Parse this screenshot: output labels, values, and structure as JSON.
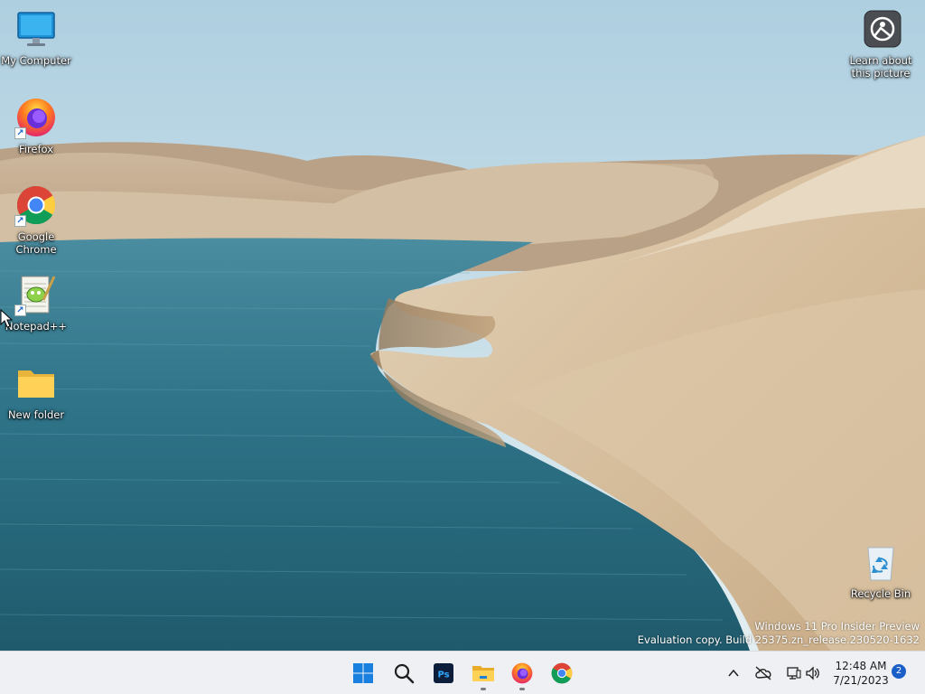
{
  "desktop": {
    "icons": [
      {
        "label": "My Computer"
      },
      {
        "label": "Firefox"
      },
      {
        "label": "Google Chrome"
      },
      {
        "label": "Notepad++"
      },
      {
        "label": "New folder"
      },
      {
        "label": "Recycle Bin"
      }
    ],
    "spotlight": {
      "label": "Learn about this picture"
    },
    "watermark": {
      "line1": "Windows 11 Pro Insider Preview",
      "line2": "Evaluation copy. Build 25375.zn_release.230520-1632"
    }
  },
  "taskbar": {
    "pinned": [
      {
        "icon": "windows-start-icon"
      },
      {
        "icon": "search-icon"
      },
      {
        "icon": "photoshop-icon"
      },
      {
        "icon": "file-explorer-icon",
        "running": true
      },
      {
        "icon": "firefox-icon",
        "running": true
      },
      {
        "icon": "chrome-icon"
      }
    ],
    "tray": {
      "time": "12:48 AM",
      "date": "7/21/2023",
      "notifications": "2",
      "icons": [
        "chevron-up-icon",
        "onedrive-offline-icon",
        "network-icon",
        "volume-icon"
      ]
    }
  },
  "colors": {
    "taskbar_bg": "#eef0f3",
    "accent": "#1a5fc8",
    "sky": "#c9dfe9",
    "water": "#2f6f82",
    "sand": "#d7c2a4"
  }
}
